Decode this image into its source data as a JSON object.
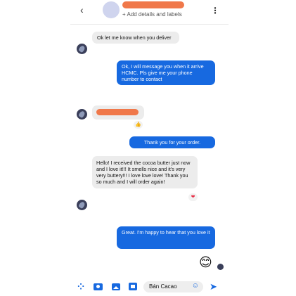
{
  "header": {
    "back_icon": "chevron-left-icon",
    "back_glyph": "‹",
    "subtitle": "+ Add details and labels",
    "more_icon": "more-vertical-icon",
    "more_glyph": "⋮"
  },
  "messages": {
    "m1": "Ok let me know when you deliver",
    "m2": "Ok, I will message you when it arrive HCMC. Pls give me your phone number to contact",
    "m3_react": "👍",
    "m4": "Thank you for your order.",
    "m5": "Hello! I received the cocoa butter just now and I love it!!! It smells nice and it's very very buttery!!! I love love love! Thank you so much and I will order again!",
    "m5_react": "❤",
    "m6": "Great. I'm happy to hear that you love it",
    "sticker": "😊"
  },
  "composer": {
    "apps_glyph": "⁘",
    "camera_glyph": "📷",
    "gallery_glyph": "🖼",
    "gif_glyph": "▣",
    "input_value": "Bán Cacao",
    "emoji_glyph": "☺",
    "send_glyph": "➤"
  },
  "colors": {
    "outgoing_bubble": "#1769e0",
    "incoming_bubble": "#ececec",
    "redacted": "#f0784a"
  }
}
